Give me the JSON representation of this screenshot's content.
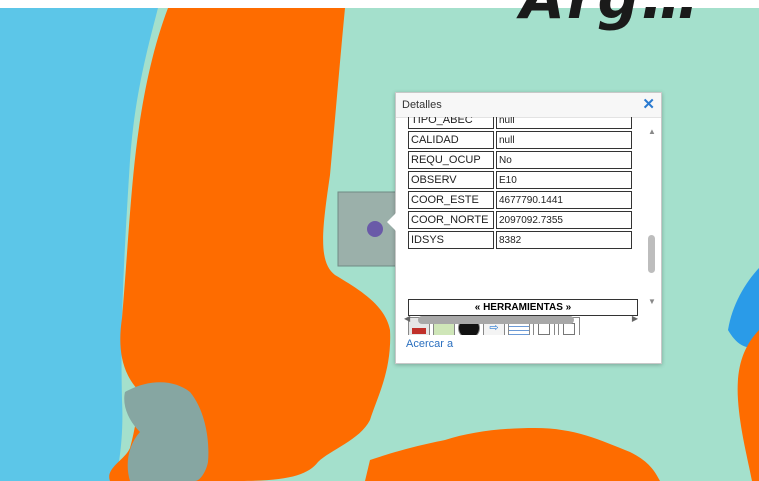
{
  "watermark_text": "Arg…",
  "colors": {
    "background": "#a4e0cc",
    "water": "#5cc6e8",
    "land_orange": "#fe6c00",
    "grey_zone": "#86a6a2",
    "selected_parcel": "#9bb0aa",
    "lake_blue": "#2a9be8",
    "marker": "#6a5aa8",
    "link": "#2a6fbf"
  },
  "popup": {
    "title": "Detalles",
    "close_icon": "close-icon",
    "rows": [
      {
        "key": "TIPO_ABEC",
        "value": "null"
      },
      {
        "key": "CALIDAD",
        "value": "null"
      },
      {
        "key": "REQU_OCUP",
        "value": "No"
      },
      {
        "key": "OBSERV",
        "value": "E10"
      },
      {
        "key": "COOR_ESTE",
        "value": "4677790.1441"
      },
      {
        "key": "COOR_NORTE",
        "value": "2097092.7355"
      },
      {
        "key": "IDSYS",
        "value": "8382"
      }
    ],
    "tools_header": "« HERRAMIENTAS »",
    "tools": [
      {
        "name": "pdf-icon",
        "kind": "pdf"
      },
      {
        "name": "map-icon",
        "kind": "map"
      },
      {
        "name": "street-view-icon",
        "kind": "eye"
      },
      {
        "name": "navigate-icon",
        "kind": "nav",
        "glyph": "⇨"
      },
      {
        "name": "table-icon",
        "kind": "grid"
      },
      {
        "name": "text-icon",
        "kind": "doc"
      },
      {
        "name": "document-icon",
        "kind": "doc"
      }
    ],
    "zoom_link": "Acercar a"
  }
}
